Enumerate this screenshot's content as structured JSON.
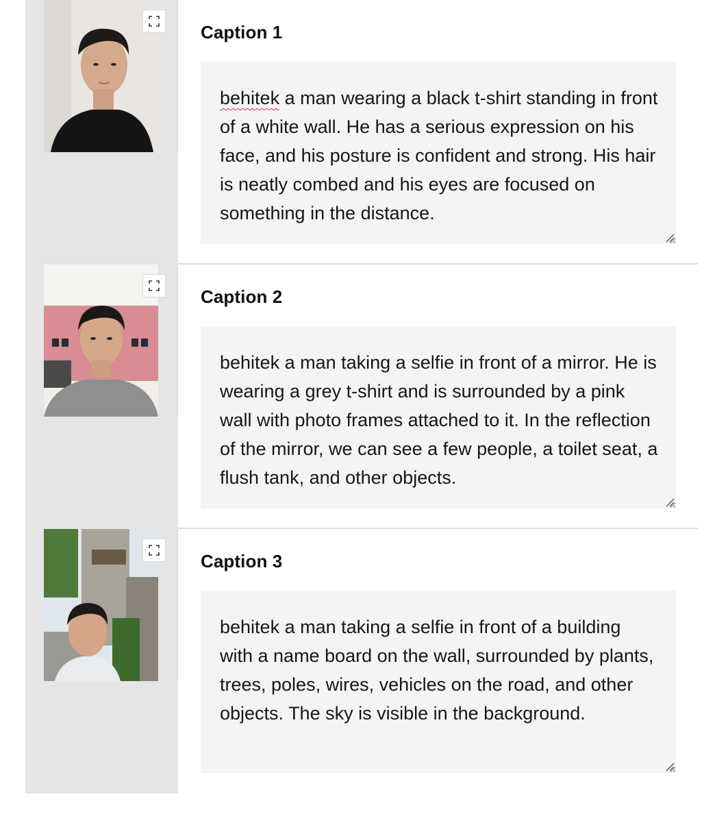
{
  "items": [
    {
      "caption_title": "Caption 1",
      "caption_first_word": "behitek",
      "caption_rest": " a man wearing a black t-shirt standing in front of a white wall. He has a serious expression on his face, and his posture is confident and strong. His hair is neatly combed and his eyes are focused on something in the distance.",
      "photo_icon": "portrait-photo-icon",
      "expand_icon": "expand-icon"
    },
    {
      "caption_title": "Caption 2",
      "caption_first_word": "behitek",
      "caption_rest": " a man taking a selfie in front of a mirror. He is wearing a grey t-shirt and is surrounded by a pink wall with photo frames attached to it. In the reflection of the mirror, we can see a few people, a toilet seat, a flush tank, and other objects.",
      "photo_icon": "selfie-photo-icon",
      "expand_icon": "expand-icon"
    },
    {
      "caption_title": "Caption 3",
      "caption_first_word": "behitek",
      "caption_rest": " a man taking a selfie in front of a building with a name board on the wall, surrounded by plants, trees, poles, wires, vehicles on the road, and other objects. The sky is visible in the background.",
      "photo_icon": "outdoor-selfie-photo-icon",
      "expand_icon": "expand-icon"
    }
  ]
}
